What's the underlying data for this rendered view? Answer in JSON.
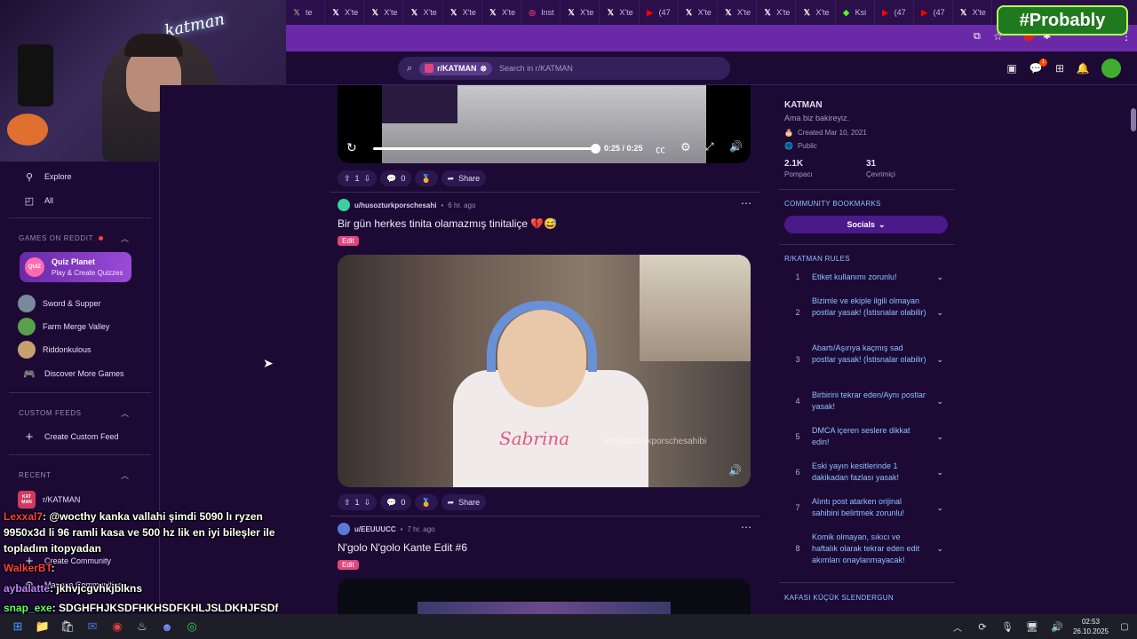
{
  "browser": {
    "tabs": [
      {
        "icon": "x-icon",
        "label": "te",
        "color": "#888888"
      },
      {
        "icon": "x-icon",
        "label": "X'te",
        "color": "#ffffff"
      },
      {
        "icon": "x-icon",
        "label": "X'te",
        "color": "#ffffff"
      },
      {
        "icon": "x-icon",
        "label": "X'te",
        "color": "#ffffff"
      },
      {
        "icon": "x-icon",
        "label": "X'te",
        "color": "#ffffff"
      },
      {
        "icon": "x-icon",
        "label": "X'te",
        "color": "#ffffff"
      },
      {
        "icon": "instagram-icon",
        "label": "Inst",
        "color": "#e1306c"
      },
      {
        "icon": "x-icon",
        "label": "X'te",
        "color": "#ffffff"
      },
      {
        "icon": "x-icon",
        "label": "X'te",
        "color": "#ffffff"
      },
      {
        "icon": "youtube-icon",
        "label": "(47",
        "color": "#ff0000"
      },
      {
        "icon": "x-icon",
        "label": "X'te",
        "color": "#ffffff"
      },
      {
        "icon": "x-icon",
        "label": "X'te",
        "color": "#ffffff"
      },
      {
        "icon": "x-icon",
        "label": "X'te",
        "color": "#ffffff"
      },
      {
        "icon": "x-icon",
        "label": "X'te",
        "color": "#ffffff"
      },
      {
        "icon": "kick-icon",
        "label": "Ksi",
        "color": "#53fc18"
      },
      {
        "icon": "youtube-icon",
        "label": "(47",
        "color": "#ff0000"
      },
      {
        "icon": "youtube-icon",
        "label": "(47",
        "color": "#ff0000"
      },
      {
        "icon": "x-icon",
        "label": "X'te",
        "color": "#ffffff"
      }
    ]
  },
  "overlay": {
    "brand": "#Probably",
    "webcam_sign": "katman"
  },
  "search": {
    "community_chip": "r/KATMAN",
    "placeholder": "Search in r/KATMAN"
  },
  "header": {
    "notification_count": "1"
  },
  "sidebar": {
    "explore": "Explore",
    "all": "All",
    "games_section": "GAMES ON REDDIT",
    "quiz_title": "Quiz Planet",
    "quiz_sub": "Play & Create Quizzes",
    "quiz_badge": "QUIZ",
    "games": [
      "Sword & Supper",
      "Farm Merge Valley",
      "Riddonkulous"
    ],
    "discover": "Discover More Games",
    "custom_feeds_section": "CUSTOM FEEDS",
    "create_feed": "Create Custom Feed",
    "recent_section": "RECENT",
    "recent_item": "r/KATMAN",
    "recent_badge": "KAT MAN",
    "create_community": "Create Community",
    "manage_communities": "Manage Communities"
  },
  "video_post": {
    "time": "0:25 / 0:25",
    "upvotes": "1",
    "comments": "0",
    "share": "Share"
  },
  "post1": {
    "author": "u/husozturkporschesahi",
    "time": "6 hr. ago",
    "title": "Bir gün herkes tinita olamazmış tinitaliçe 💔😅",
    "flair": "Edit",
    "watermark": "@husozturkporschesahibi",
    "shirt_text": "Sabrina",
    "upvotes": "1",
    "comments": "0",
    "share": "Share"
  },
  "post2": {
    "author": "u/EEUUUCC",
    "time": "7 hr. ago",
    "title": "N'golo N'golo Kante Edit #6",
    "flair": "Edit"
  },
  "community": {
    "name": "KATMAN",
    "tagline": "Ama biz bakireyiz.",
    "created": "Created Mar 10, 2021",
    "visibility": "Public",
    "members": "2.1K",
    "members_label": "Pompacı",
    "online": "31",
    "online_label": "Çevrimiçi",
    "bookmarks_section": "COMMUNITY BOOKMARKS",
    "socials": "Socials",
    "rules_section": "R/KATMAN RULES",
    "rules": [
      "Etiket kullanımı zorunlu!",
      "Bizimle ve ekiple ilgili olmayan postlar yasak! (İstisnalar olabilir)",
      "Abartı/Aşırıya kaçmış sad postlar yasak! (İstisnalar olabilir)",
      "Birbirini tekrar eden/Aynı postlar yasak!",
      "DMCA içeren seslere dikkat edin!",
      "Eski yayın kesitlerinde 1 dakikadan fazlası yasak!",
      "Alıntı post atarken orijinal sahibini belirtmek zorunlu!",
      "Komik olmayan, sıkıcı ve haftalık olarak tekrar eden edit akımları onaylanmayacak!"
    ],
    "next_section": "KAFASI KÜÇÜK SLENDERGUN"
  },
  "chat": [
    {
      "user": "Lexxal7",
      "user_color": "#ff4040",
      "text": ": @wocthy kanka vallahi şimdi 5090 lı ryzen"
    },
    {
      "user": "",
      "user_color": "#ffffff",
      "text": "9950x3d li 96 ramli kasa ve 500 hz lik en iyi bileşler ile"
    },
    {
      "user": "",
      "user_color": "#ffffff",
      "text": "topladım itopyadan"
    },
    {
      "user": "WalkerBT",
      "user_color": "#ff4040",
      "text": ":"
    },
    {
      "user": "aybalatte",
      "user_color": "#c080ff",
      "text": ": jkhvjcgvhkjblkns"
    },
    {
      "user": "snap_exe",
      "user_color": "#60ff60",
      "text": ": SDGHFHJKSDFHKHSDFKHLJSLDKHJFSDf"
    }
  ],
  "taskbar": {
    "time": "02:53",
    "date": "26.10.2025"
  }
}
